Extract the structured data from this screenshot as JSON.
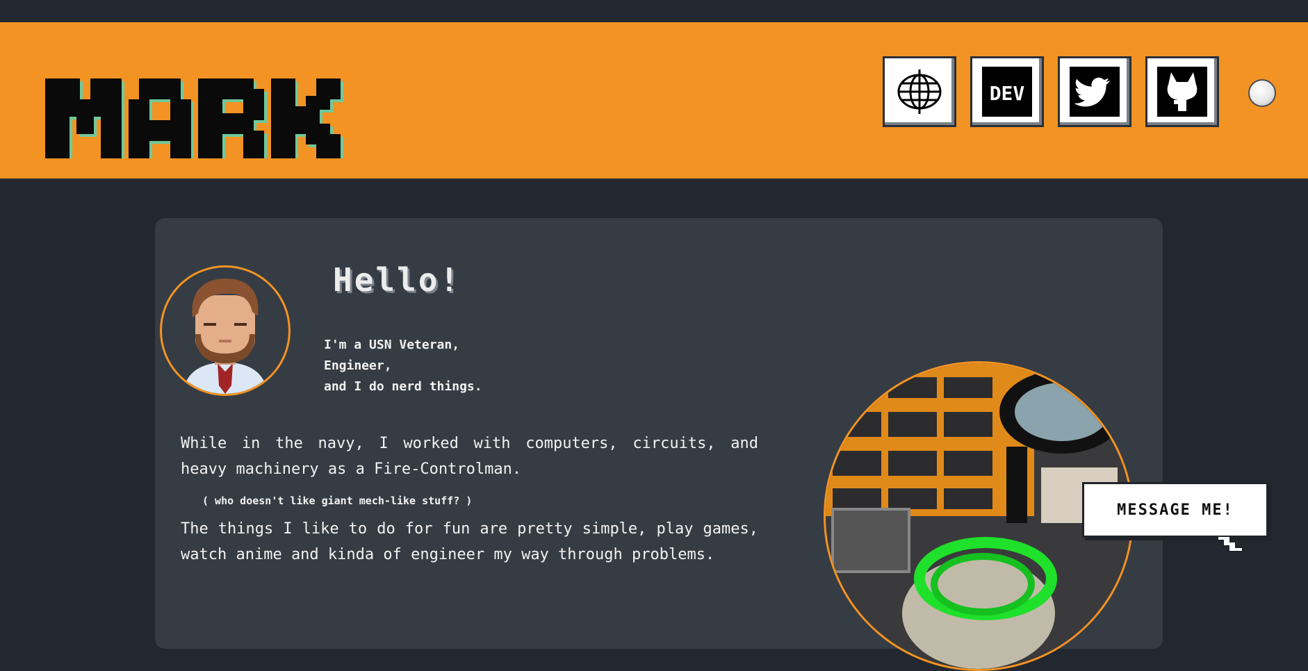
{
  "header": {
    "logo_text": "MARK",
    "social_links": [
      {
        "name": "website",
        "icon": "globe-icon"
      },
      {
        "name": "dev",
        "icon": "dev-icon",
        "label": "DEV"
      },
      {
        "name": "twitter",
        "icon": "twitter-icon"
      },
      {
        "name": "github",
        "icon": "github-icon"
      }
    ],
    "theme_toggle": "theme-toggle"
  },
  "main": {
    "greeting": "Hello!",
    "intro_lines": [
      "I'm a USN Veteran,",
      "Engineer,",
      "and I do nerd things."
    ],
    "paragraph_1": "While in the navy, I worked with computers, circuits, and heavy machinery as a Fire-Controlman.",
    "aside": "( who doesn't like giant mech-like stuff? )",
    "paragraph_2": "The things I like to do for fun are pretty simple, play games, watch anime and kinda of engineer my way through problems.",
    "message_button": "MESSAGE ME!"
  },
  "colors": {
    "accent": "#f39323",
    "page_bg": "#232830",
    "card_bg": "#363c44",
    "logo_shadow": "#6fc99c"
  }
}
